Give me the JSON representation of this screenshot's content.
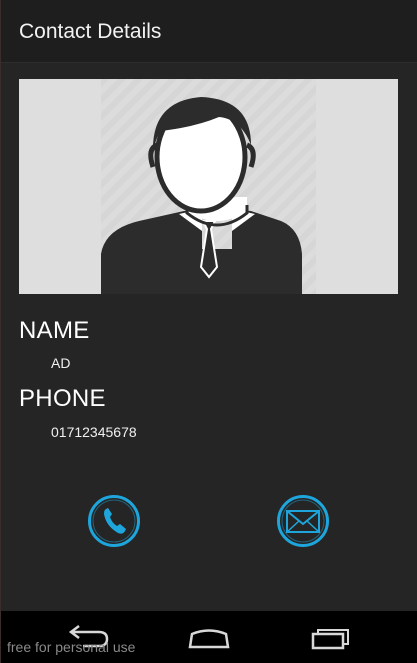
{
  "action_bar": {
    "title": "Contact Details"
  },
  "contact": {
    "photo_icon": "person-silhouette-icon",
    "name_label": "NAME",
    "name_value": "AD",
    "phone_label": "PHONE",
    "phone_value": "01712345678"
  },
  "actions": {
    "call_icon": "phone-icon",
    "email_icon": "envelope-icon"
  },
  "nav_bar": {
    "back_icon": "back-arrow-icon",
    "home_icon": "home-icon",
    "recents_icon": "recent-apps-icon",
    "watermark": "free for personal use"
  },
  "colors": {
    "accent": "#1ea6dc",
    "background": "#252525",
    "action_bar": "#1e1e1e",
    "nav_bar": "#000000"
  }
}
